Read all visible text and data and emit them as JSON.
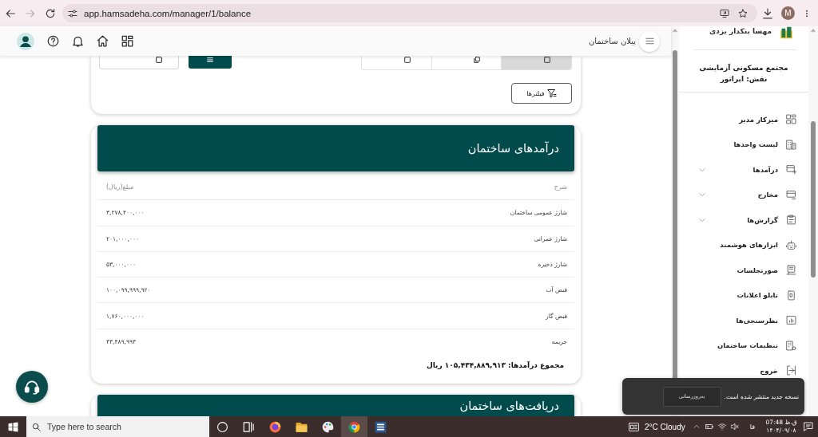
{
  "browser": {
    "back_disabled": false,
    "forward_disabled": true,
    "url": "app.hamsadeha.com/manager/1/balance",
    "profile_initial": "M"
  },
  "header": {
    "title": "پیلان ساختمان"
  },
  "toolbar_card": {
    "view_segments": [
      {
        "selected": true
      },
      {
        "selected": false
      },
      {
        "selected": false
      }
    ],
    "filter_button": "فیلترها"
  },
  "income_card": {
    "title": "درآمدهای ساختمان",
    "columns": [
      "شرح",
      "مبلغ(ریال)"
    ],
    "rows": [
      {
        "description": "شارژ عمومی ساختمان",
        "amount": "۳,۲۷۸,۴۰۰,۰۰۰"
      },
      {
        "description": "شارژ عمرانی",
        "amount": "۲۰۱,۰۰۰,۰۰۰"
      },
      {
        "description": "شارژ ذخیره",
        "amount": "۵۳,۰۰۰,۰۰۰"
      },
      {
        "description": "قبض آب",
        "amount": "۱۰۰,۰۹۹,۹۹۹,۹۲۰"
      },
      {
        "description": "قبض گاز",
        "amount": "۱,۷۶۰,۰۰۰,۰۰۰"
      },
      {
        "description": "جریمه",
        "amount": "۴۳,۴۸۹,۹۹۳"
      }
    ],
    "total": "مجموع درآمدها: ۱۰۵,۴۳۴,۸۸۹,۹۱۳ ریال"
  },
  "receipts_card": {
    "title": "دریافت‌های ساختمان"
  },
  "sidebar": {
    "user_name": "مهسا بنکدار یزدی",
    "complex_name": "مجتمع مسکونی آزمایشی",
    "role": "نقش: اپراتور",
    "items": [
      {
        "label": "میزکار مدیر",
        "kind": "link"
      },
      {
        "label": "لیست واحدها",
        "kind": "link"
      },
      {
        "label": "درآمدها",
        "kind": "group",
        "expanded": false
      },
      {
        "label": "مخارج",
        "kind": "group",
        "expanded": false
      },
      {
        "label": "گزارش‌ها",
        "kind": "group",
        "expanded": false
      },
      {
        "label": "ابزارهای هوشمند",
        "kind": "link"
      },
      {
        "label": "صورتجلسات",
        "kind": "link"
      },
      {
        "label": "تابلو اعلانات",
        "kind": "link"
      },
      {
        "label": "نظرسنجی‌ها",
        "kind": "link"
      },
      {
        "label": "تنظیمات ساختمان",
        "kind": "link"
      },
      {
        "label": "خروج",
        "kind": "link"
      }
    ]
  },
  "toast": {
    "message": "نسخه جدید منتشر شده است.",
    "action": "به‌روزرسانی"
  },
  "taskbar": {
    "search_placeholder": "Type here to search",
    "pinned": [
      {
        "active": false
      },
      {
        "active": false
      },
      {
        "active": false
      },
      {
        "active": false
      },
      {
        "active": false
      },
      {
        "active": true
      },
      {
        "active": false
      }
    ],
    "weather": "2°C Cloudy",
    "language": "فا",
    "time": "ق.ظ 07:48",
    "date": "۱۴۰۴/۰۹/۰۸"
  }
}
